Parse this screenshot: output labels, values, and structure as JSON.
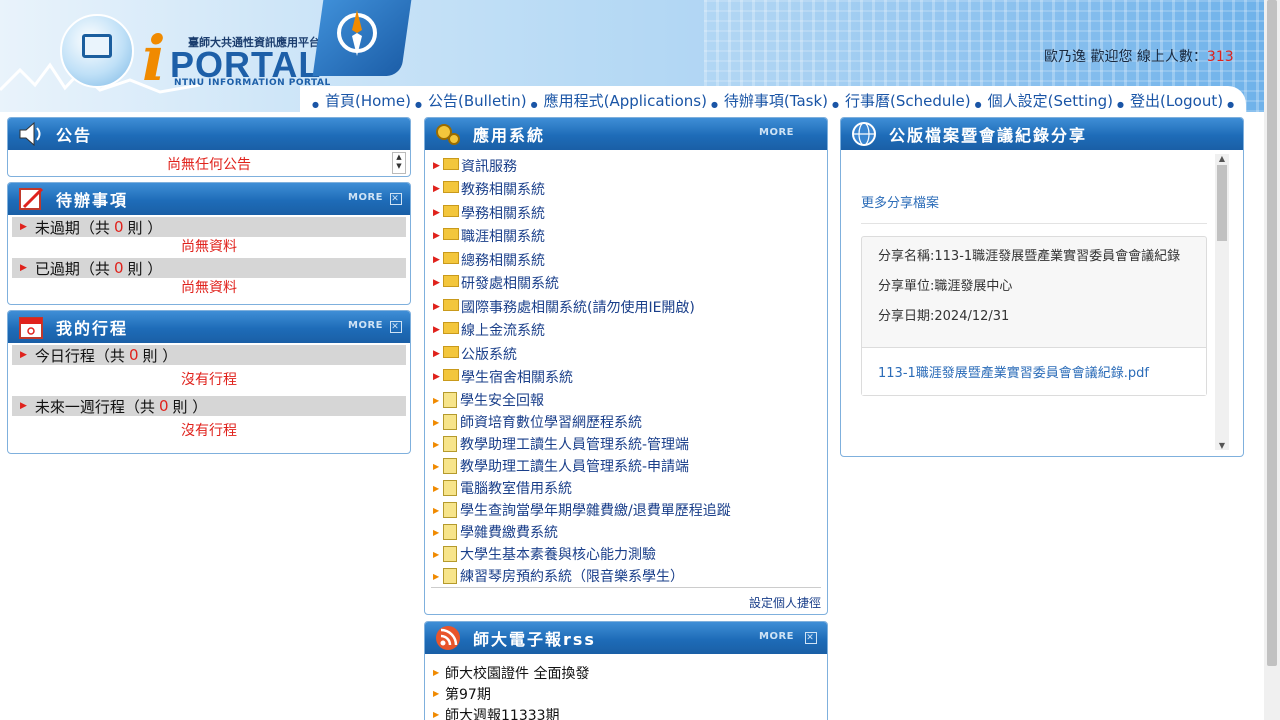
{
  "header": {
    "logo_text": "PORTAL",
    "logo_sub": "NTNU INFORMATION PORTAL",
    "logo_cn": "臺師大共通性資訊應用平台",
    "welcome_text": "歐乃逸 歡迎您 線上人數：",
    "online_count": "313"
  },
  "nav": {
    "items": [
      "首頁(Home)",
      "公告(Bulletin)",
      "應用程式(Applications)",
      "待辦事項(Task)",
      "行事曆(Schedule)",
      "個人設定(Setting)",
      "登出(Logout)"
    ]
  },
  "bulletin": {
    "title": "公告",
    "empty": "尚無任何公告"
  },
  "todo": {
    "title": "待辦事項",
    "more": "MORE",
    "not_overdue_label": "未過期（共",
    "not_overdue_count": "0",
    "overdue_label": "已過期（共",
    "overdue_count": "0",
    "unit": "則 ）",
    "empty": "尚無資料"
  },
  "schedule": {
    "title": "我的行程",
    "more": "MORE",
    "today_label": "今日行程（共",
    "today_count": "0",
    "week_label": "未來一週行程（共",
    "week_count": "0",
    "unit": "則 ）",
    "empty": "沒有行程"
  },
  "apps": {
    "title": "應用系統",
    "more": "MORE",
    "folders": [
      "資訊服務",
      "教務相關系統",
      "學務相關系統",
      "職涯相關系統",
      "總務相關系統",
      "研發處相關系統",
      "國際事務處相關系統(請勿使用IE開啟)",
      "線上金流系統",
      "公版系統",
      "學生宿舍相關系統"
    ],
    "items": [
      "學生安全回報",
      "師資培育數位學習網歷程系統",
      "教學助理工讀生人員管理系統-管理端",
      "教學助理工讀生人員管理系統-申請端",
      "電腦教室借用系統",
      "學生查詢當學年期學雜費繳/退費單歷程追蹤",
      "學雜費繳費系統",
      "大學生基本素養與核心能力測驗",
      "練習琴房預約系統（限音樂系學生）"
    ],
    "footer": "設定個人捷徑"
  },
  "rss": {
    "title": "師大電子報rss",
    "more": "MORE",
    "items": [
      "師大校園證件 全面換發",
      "第97期",
      "師大週報11333期"
    ]
  },
  "share": {
    "title": "公版檔案暨會議紀錄分享",
    "more_link": "更多分享檔案",
    "name_label": "分享名稱:113-1職涯發展暨產業實習委員會會議紀錄",
    "unit_label": "分享單位:職涯發展中心",
    "date_label": "分享日期:2024/12/31",
    "file": "113-1職涯發展暨產業實習委員會會議紀錄.pdf"
  },
  "colors": {
    "accent": "#1e6cb8",
    "alert": "#e0221c",
    "link": "#1a55a6"
  }
}
